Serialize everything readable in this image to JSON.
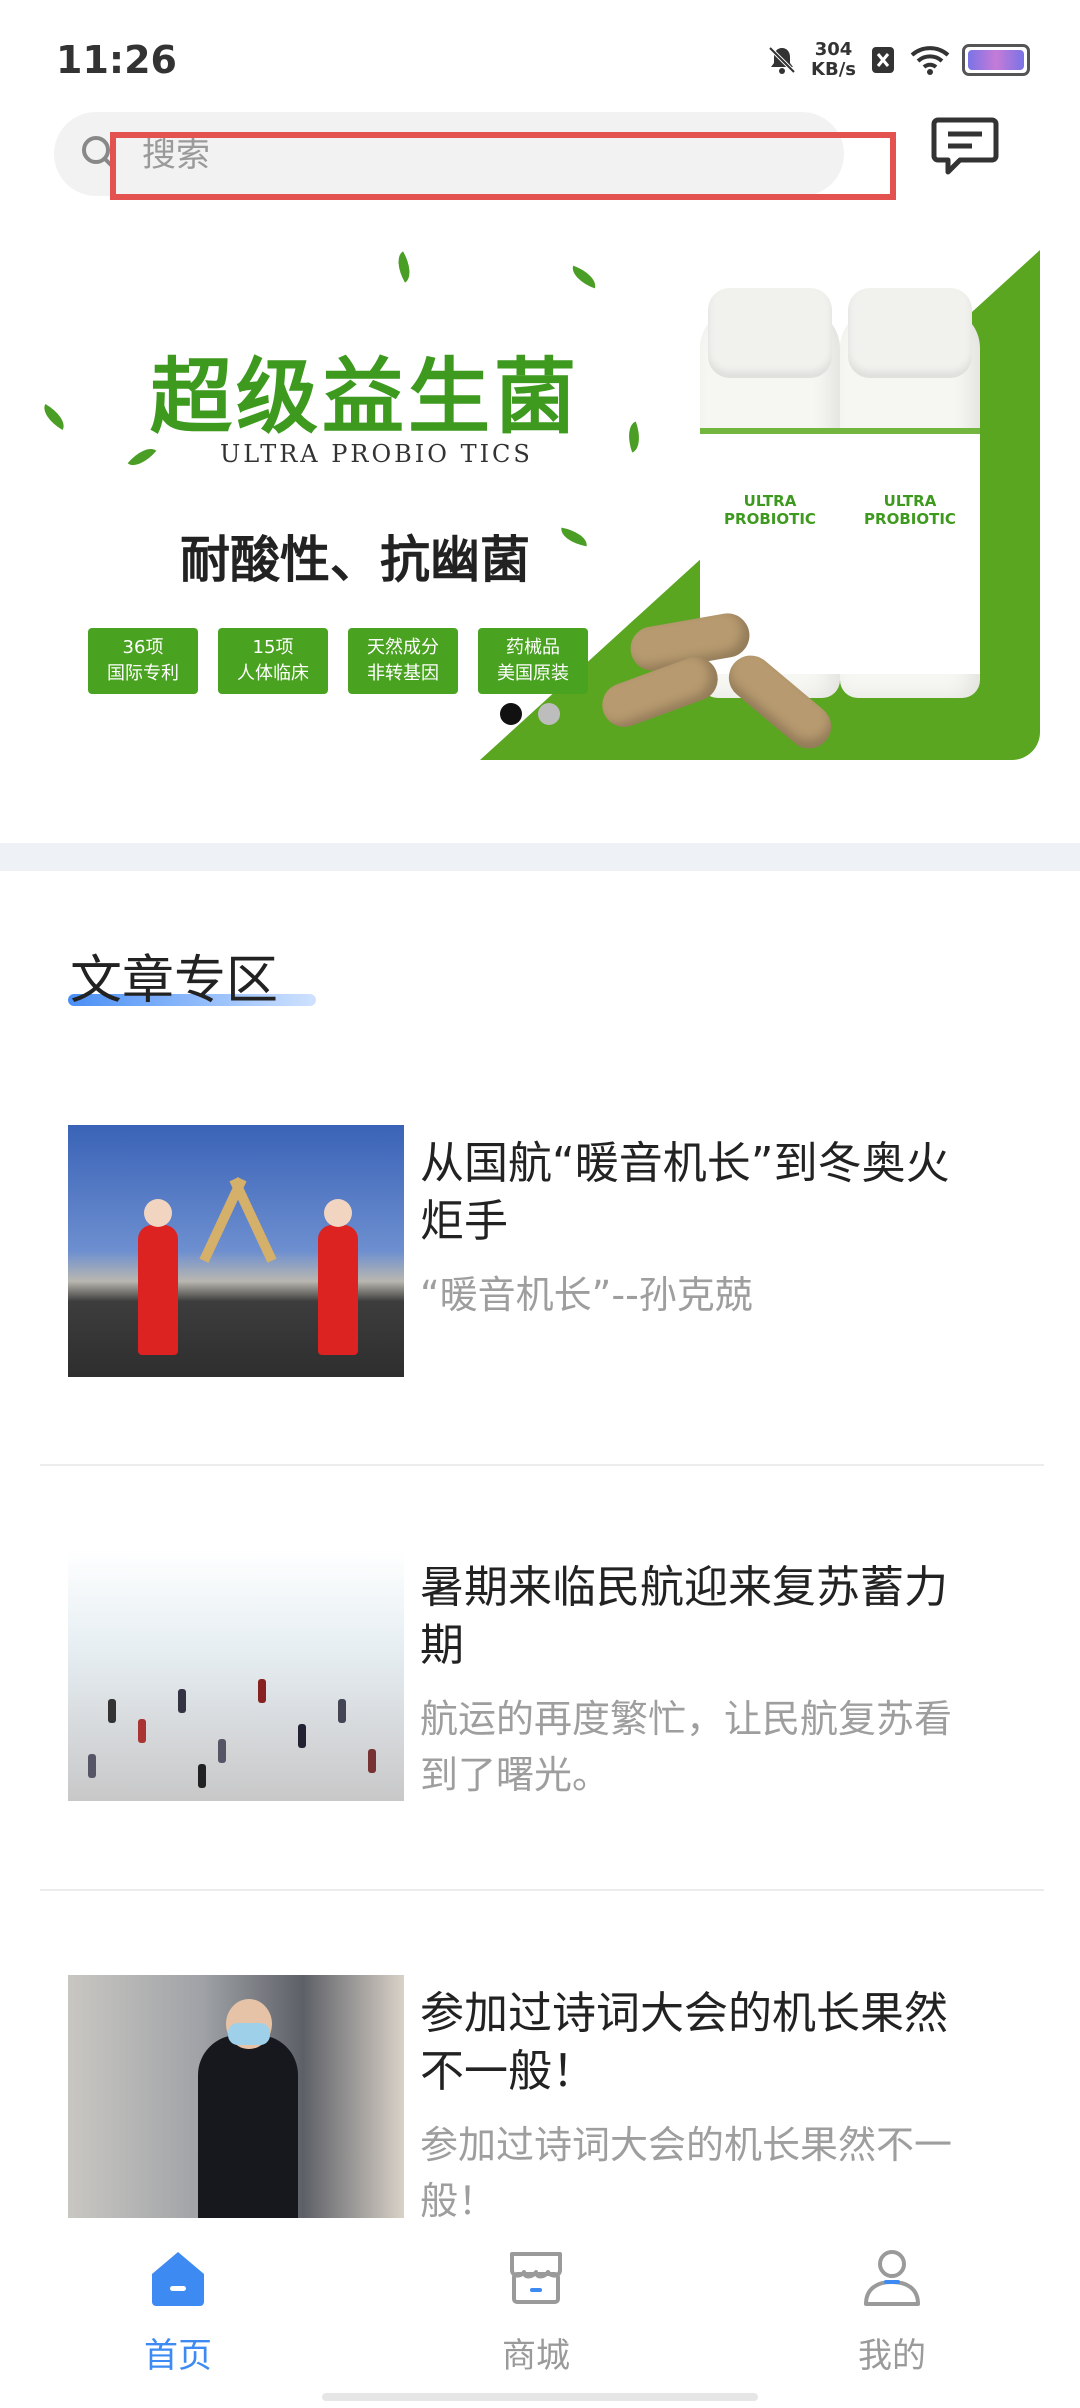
{
  "status_bar": {
    "time": "11:26",
    "net_speed_value": "304",
    "net_speed_unit": "KB/s"
  },
  "search": {
    "placeholder": "搜索"
  },
  "banner": {
    "title": "超级益生菌",
    "subtitle": "ULTRA PROBIO TICS",
    "slogan": "耐酸性、抗幽菌",
    "tags": [
      {
        "line1": "36项",
        "line2": "国际专利"
      },
      {
        "line1": "15项",
        "line2": "人体临床"
      },
      {
        "line1": "天然成分",
        "line2": "非转基因"
      },
      {
        "line1": "药械品",
        "line2": "美国原装"
      }
    ],
    "bottle_label": "ULTRA PROBIOTIC",
    "active_slide": 1,
    "slide_count": 2
  },
  "section": {
    "title": "文章专区"
  },
  "articles": [
    {
      "title": "从国航“暖音机长”到冬奥火炬手",
      "summary": "“暖音机长”--孙克兢"
    },
    {
      "title": "暑期来临民航迎来复苏蓄力期",
      "summary": "航运的再度繁忙，让民航复苏看到了曙光。"
    },
    {
      "title": "参加过诗词大会的机长果然不一般！",
      "summary": "参加过诗词大会的机长果然不一般！"
    }
  ],
  "tabbar": {
    "tabs": [
      {
        "label": "首页",
        "icon": "home-icon",
        "active": true
      },
      {
        "label": "商城",
        "icon": "store-icon",
        "active": false
      },
      {
        "label": "我的",
        "icon": "profile-icon",
        "active": false
      }
    ]
  },
  "colors": {
    "accent": "#3d8bf2",
    "brand_green": "#5aa620",
    "highlight_red": "#e4524f"
  }
}
